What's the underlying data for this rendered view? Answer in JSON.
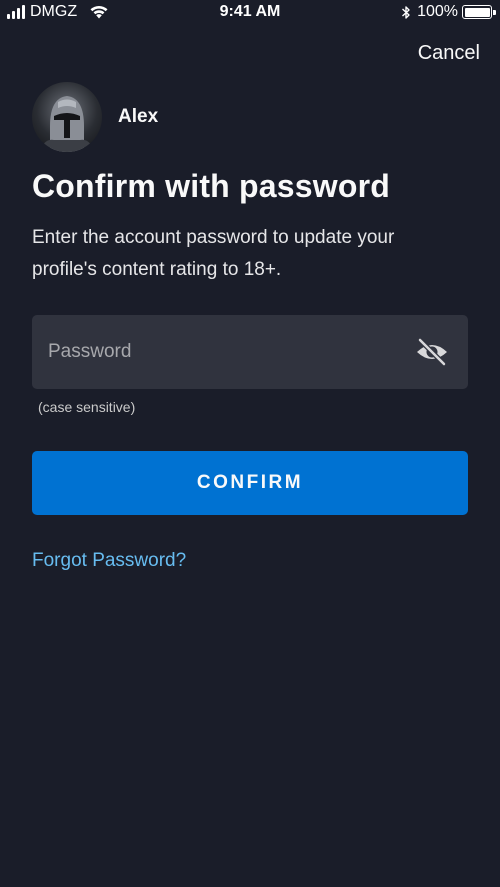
{
  "status_bar": {
    "carrier": "DMGZ",
    "time": "9:41 AM",
    "battery_percent": "100%",
    "battery_level": 1.0
  },
  "header": {
    "cancel_label": "Cancel"
  },
  "profile": {
    "name": "Alex"
  },
  "main": {
    "title": "Confirm with password",
    "description": "Enter the account password to update your profile's content rating to 18+.",
    "password_placeholder": "Password",
    "password_value": "",
    "password_hint": "(case sensitive)",
    "confirm_label": "CONFIRM",
    "forgot_label": "Forgot Password?"
  },
  "icons": {
    "visibility_toggle": "eye-slash-icon"
  },
  "colors": {
    "background": "#1a1d29",
    "field_background": "#30333e",
    "accent": "#0072d2",
    "link": "#67bcf0"
  }
}
